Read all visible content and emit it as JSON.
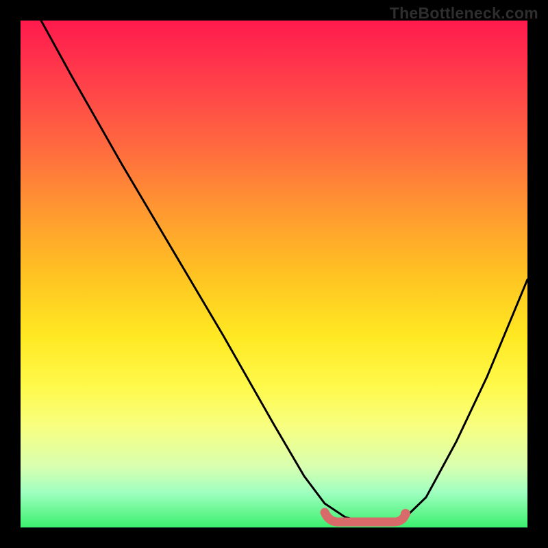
{
  "watermark": "TheBottleneck.com",
  "chart_data": {
    "type": "line",
    "title": "",
    "xlabel": "",
    "ylabel": "",
    "xlim": [
      0,
      1
    ],
    "ylim": [
      0,
      1
    ],
    "gradient_stops": [
      {
        "pos": 0.0,
        "color": "#ff1a4d"
      },
      {
        "pos": 0.12,
        "color": "#ff3f4a"
      },
      {
        "pos": 0.25,
        "color": "#ff6a3f"
      },
      {
        "pos": 0.38,
        "color": "#ff9a30"
      },
      {
        "pos": 0.5,
        "color": "#ffc222"
      },
      {
        "pos": 0.62,
        "color": "#ffe822"
      },
      {
        "pos": 0.72,
        "color": "#fff94a"
      },
      {
        "pos": 0.8,
        "color": "#f8ff80"
      },
      {
        "pos": 0.88,
        "color": "#d8ffb0"
      },
      {
        "pos": 0.93,
        "color": "#a0ffc0"
      },
      {
        "pos": 1.0,
        "color": "#3cf06e"
      }
    ],
    "series": [
      {
        "name": "bottleneck-curve",
        "color": "#000000",
        "x": [
          0.04,
          0.1,
          0.2,
          0.3,
          0.4,
          0.5,
          0.56,
          0.6,
          0.64,
          0.68,
          0.72,
          0.76,
          0.8,
          0.86,
          0.92,
          1.0
        ],
        "y": [
          1.0,
          0.89,
          0.72,
          0.55,
          0.38,
          0.2,
          0.1,
          0.05,
          0.02,
          0.01,
          0.01,
          0.02,
          0.06,
          0.17,
          0.3,
          0.49
        ]
      },
      {
        "name": "optimal-range-marker",
        "color": "#d86a6a",
        "x": [
          0.6,
          0.76
        ],
        "y": [
          0.015,
          0.015
        ]
      }
    ],
    "optimal_range": {
      "start": 0.6,
      "end": 0.76
    },
    "marker_point": {
      "x": 0.76,
      "y": 0.018
    }
  }
}
